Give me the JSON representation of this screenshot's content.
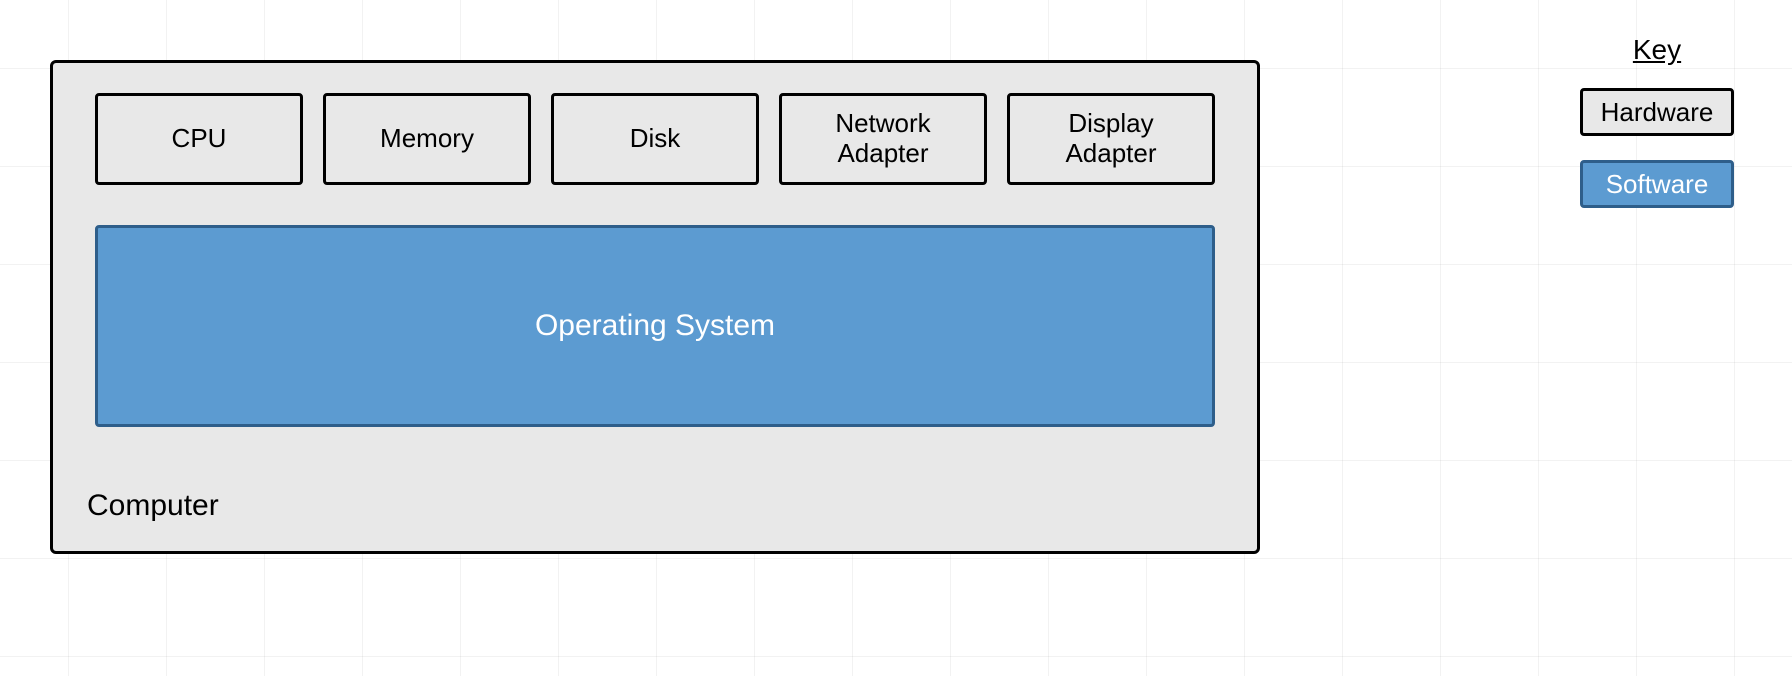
{
  "diagram": {
    "container_label": "Computer",
    "hardware": [
      "CPU",
      "Memory",
      "Disk",
      "Network\nAdapter",
      "Display\nAdapter"
    ],
    "software_box": "Operating System"
  },
  "legend": {
    "title": "Key",
    "hardware_label": "Hardware",
    "software_label": "Software"
  },
  "colors": {
    "box_bg": "#e8e8e8",
    "box_border": "#000000",
    "software_bg": "#5c9bd1",
    "software_border": "#2e5e8a",
    "software_text": "#ffffff"
  }
}
